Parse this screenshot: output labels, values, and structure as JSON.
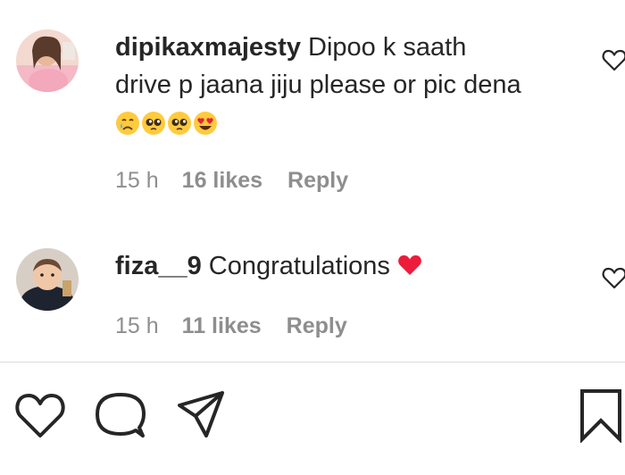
{
  "comments": [
    {
      "username": "dipikaxmajesty",
      "text_line1": "Dipoo k saath",
      "text_line2": "drive p jaana jiju please or pic dena",
      "emojis": [
        "crying-face",
        "pleading-face",
        "pleading-face",
        "heart-eyes-face"
      ],
      "time": "15 h",
      "likes": "16 likes",
      "reply": "Reply"
    },
    {
      "username": "fiza__9",
      "text": "Congratulations",
      "emoji": "red-heart",
      "time": "15 h",
      "likes": "11 likes",
      "reply": "Reply"
    }
  ],
  "actions": [
    "heart-icon",
    "comment-icon",
    "share-icon",
    "bookmark-icon"
  ],
  "colors": {
    "text": "#262626",
    "muted": "#8e8e8e",
    "divider": "#dbdbdb",
    "heart_red": "#ed1c3a"
  }
}
